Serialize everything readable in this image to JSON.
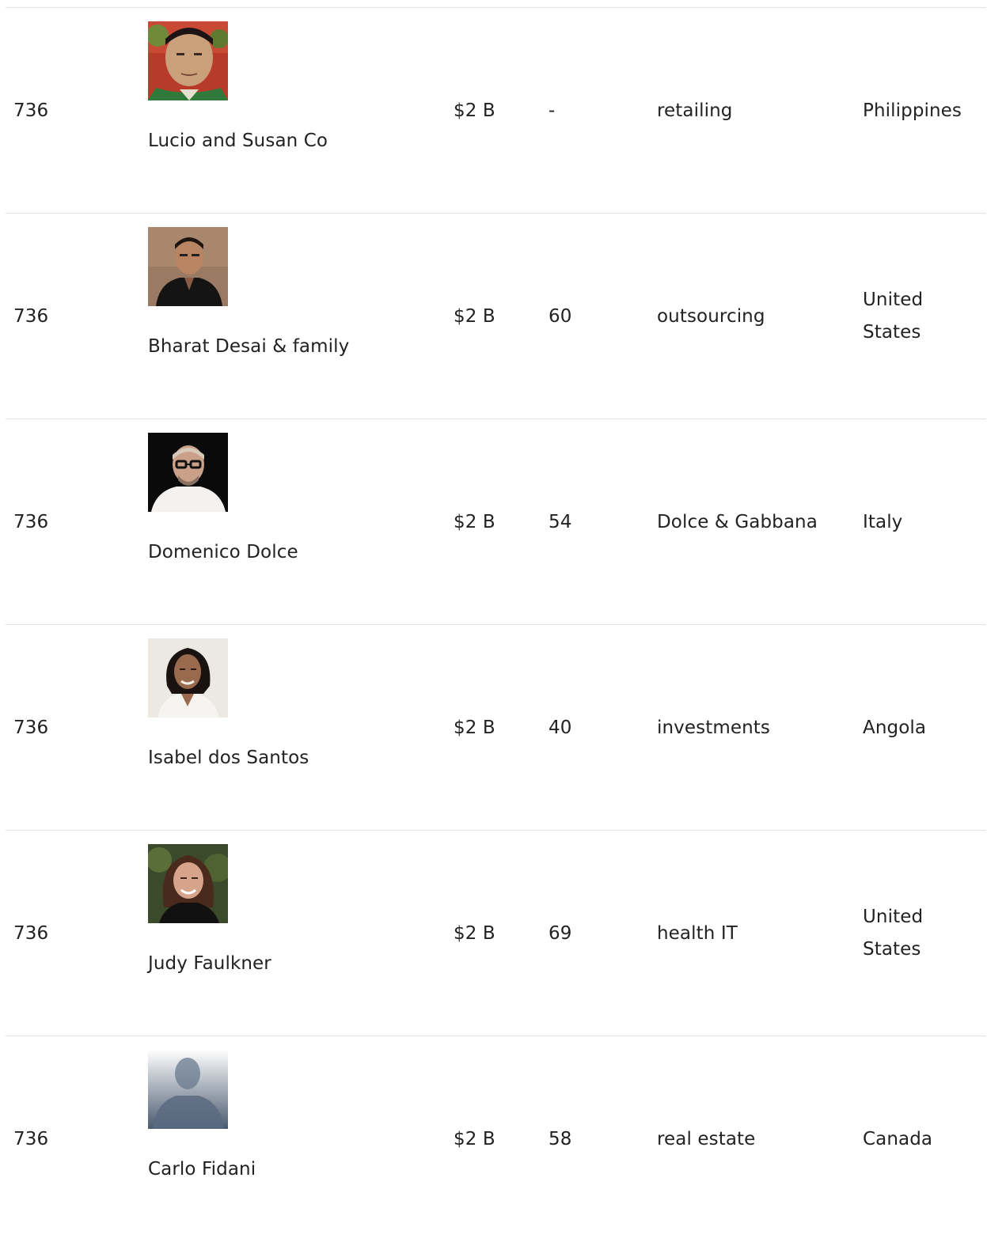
{
  "rows": [
    {
      "rank": "736",
      "name": "Lucio and Susan Co",
      "photo": "portrait-photo-lucio-and-susan-co",
      "net_worth": "$2 B",
      "age": "-",
      "source": "retailing",
      "country": "Philippines"
    },
    {
      "rank": "736",
      "name": "Bharat Desai & family",
      "photo": "portrait-photo-bharat-desai",
      "net_worth": "$2 B",
      "age": "60",
      "source": "outsourcing",
      "country": "United States"
    },
    {
      "rank": "736",
      "name": "Domenico Dolce",
      "photo": "portrait-photo-domenico-dolce",
      "net_worth": "$2 B",
      "age": "54",
      "source": "Dolce & Gabbana",
      "country": "Italy"
    },
    {
      "rank": "736",
      "name": "Isabel dos Santos",
      "photo": "portrait-photo-isabel-dos-santos",
      "net_worth": "$2 B",
      "age": "40",
      "source": "investments",
      "country": "Angola"
    },
    {
      "rank": "736",
      "name": "Judy Faulkner",
      "photo": "portrait-photo-judy-faulkner",
      "net_worth": "$2 B",
      "age": "69",
      "source": "health IT",
      "country": "United States"
    },
    {
      "rank": "736",
      "name": "Carlo Fidani",
      "photo": "placeholder-silhouette-icon",
      "net_worth": "$2 B",
      "age": "58",
      "source": "real estate",
      "country": "Canada"
    }
  ]
}
